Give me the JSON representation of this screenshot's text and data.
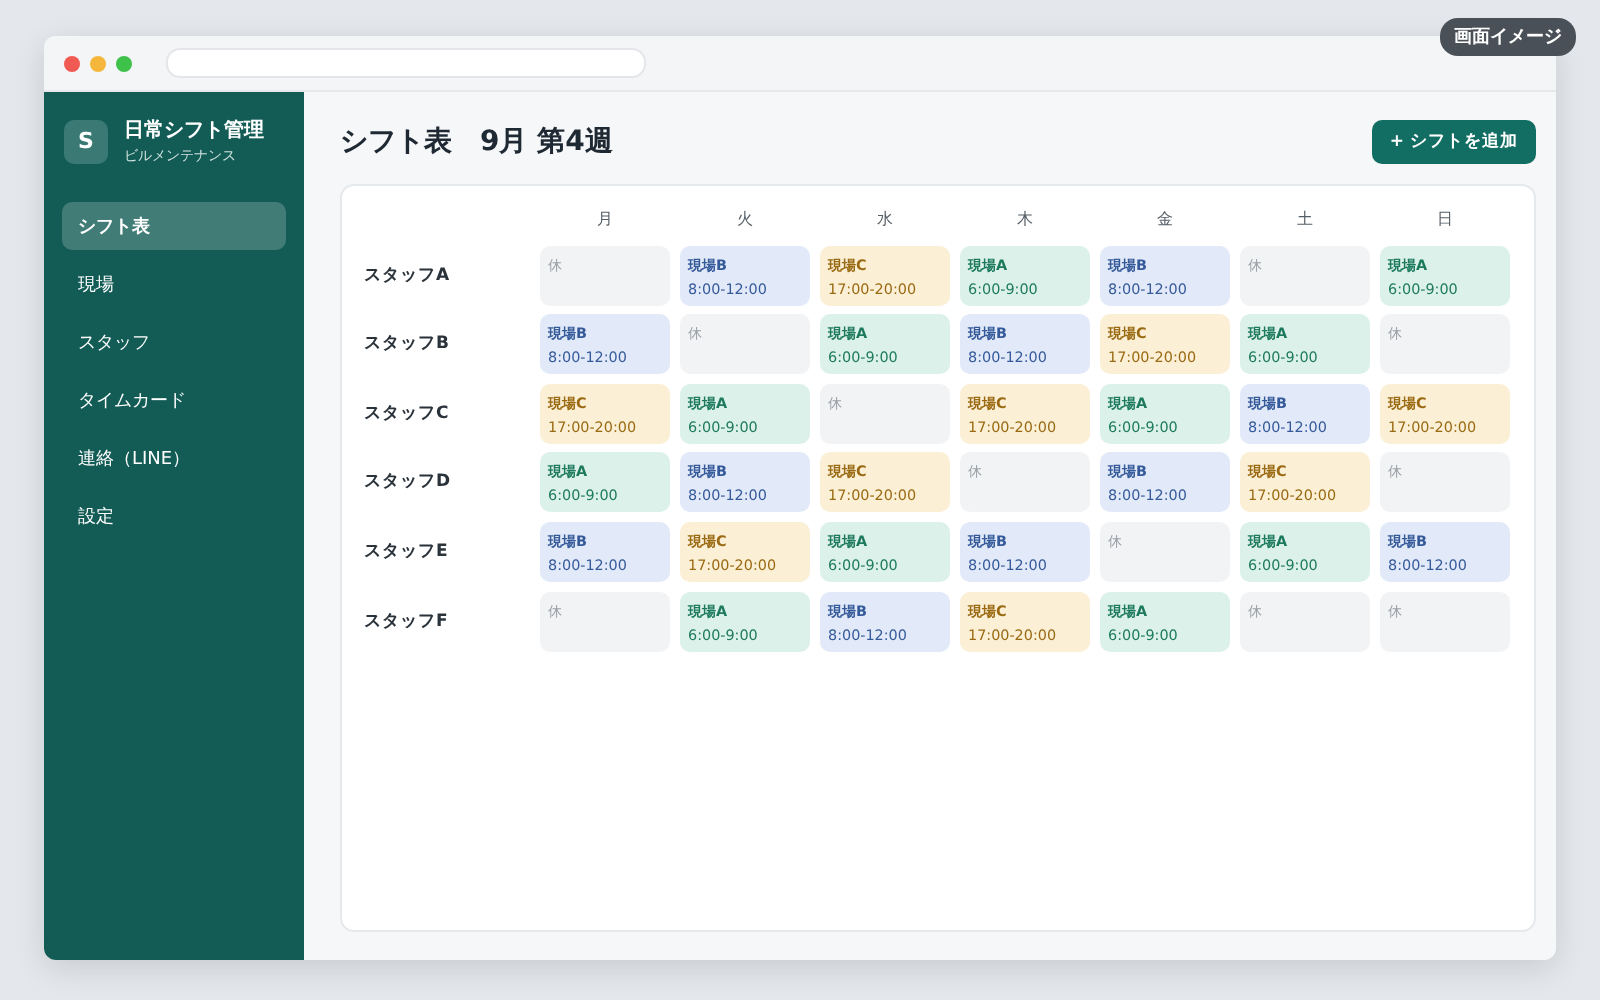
{
  "badge": "画面イメージ",
  "brand": {
    "initial": "S",
    "name": "日常シフト管理",
    "subtitle": "ビルメンテナンス"
  },
  "sidebar": {
    "items": [
      {
        "label": "シフト表",
        "selected": true
      },
      {
        "label": "現場",
        "selected": false
      },
      {
        "label": "スタッフ",
        "selected": false
      },
      {
        "label": "タイムカード",
        "selected": false
      },
      {
        "label": "連絡（LINE）",
        "selected": false
      },
      {
        "label": "設定",
        "selected": false
      }
    ]
  },
  "page_title": "シフト表　9月 第4週",
  "add_button": "+ シフトを追加",
  "table": {
    "columns": [
      "月",
      "火",
      "水",
      "木",
      "金",
      "土",
      "日"
    ],
    "rows": [
      {
        "staff": "スタッフA",
        "cells": [
          {
            "kind": "off",
            "label": "休"
          },
          {
            "kind": "b",
            "site": "現場B",
            "time": "8:00-12:00"
          },
          {
            "kind": "c",
            "site": "現場C",
            "time": "17:00-20:00"
          },
          {
            "kind": "a",
            "site": "現場A",
            "time": "6:00-9:00"
          },
          {
            "kind": "b",
            "site": "現場B",
            "time": "8:00-12:00"
          },
          {
            "kind": "off",
            "label": "休"
          },
          {
            "kind": "a",
            "site": "現場A",
            "time": "6:00-9:00"
          }
        ]
      },
      {
        "staff": "スタッフB",
        "cells": [
          {
            "kind": "b",
            "site": "現場B",
            "time": "8:00-12:00"
          },
          {
            "kind": "off",
            "label": "休"
          },
          {
            "kind": "a",
            "site": "現場A",
            "time": "6:00-9:00"
          },
          {
            "kind": "b",
            "site": "現場B",
            "time": "8:00-12:00"
          },
          {
            "kind": "c",
            "site": "現場C",
            "time": "17:00-20:00"
          },
          {
            "kind": "a",
            "site": "現場A",
            "time": "6:00-9:00"
          },
          {
            "kind": "off",
            "label": "休"
          }
        ]
      },
      {
        "staff": "スタッフC",
        "cells": [
          {
            "kind": "c",
            "site": "現場C",
            "time": "17:00-20:00"
          },
          {
            "kind": "a",
            "site": "現場A",
            "time": "6:00-9:00"
          },
          {
            "kind": "off",
            "label": "休"
          },
          {
            "kind": "c",
            "site": "現場C",
            "time": "17:00-20:00"
          },
          {
            "kind": "a",
            "site": "現場A",
            "time": "6:00-9:00"
          },
          {
            "kind": "b",
            "site": "現場B",
            "time": "8:00-12:00"
          },
          {
            "kind": "c",
            "site": "現場C",
            "time": "17:00-20:00"
          }
        ]
      },
      {
        "staff": "スタッフD",
        "cells": [
          {
            "kind": "a",
            "site": "現場A",
            "time": "6:00-9:00"
          },
          {
            "kind": "b",
            "site": "現場B",
            "time": "8:00-12:00"
          },
          {
            "kind": "c",
            "site": "現場C",
            "time": "17:00-20:00"
          },
          {
            "kind": "off",
            "label": "休"
          },
          {
            "kind": "b",
            "site": "現場B",
            "time": "8:00-12:00"
          },
          {
            "kind": "c",
            "site": "現場C",
            "time": "17:00-20:00"
          },
          {
            "kind": "off",
            "label": "休"
          }
        ]
      },
      {
        "staff": "スタッフE",
        "cells": [
          {
            "kind": "b",
            "site": "現場B",
            "time": "8:00-12:00"
          },
          {
            "kind": "c",
            "site": "現場C",
            "time": "17:00-20:00"
          },
          {
            "kind": "a",
            "site": "現場A",
            "time": "6:00-9:00"
          },
          {
            "kind": "b",
            "site": "現場B",
            "time": "8:00-12:00"
          },
          {
            "kind": "off",
            "label": "休"
          },
          {
            "kind": "a",
            "site": "現場A",
            "time": "6:00-9:00"
          },
          {
            "kind": "b",
            "site": "現場B",
            "time": "8:00-12:00"
          }
        ]
      },
      {
        "staff": "スタッフF",
        "cells": [
          {
            "kind": "off",
            "label": "休"
          },
          {
            "kind": "a",
            "site": "現場A",
            "time": "6:00-9:00"
          },
          {
            "kind": "b",
            "site": "現場B",
            "time": "8:00-12:00"
          },
          {
            "kind": "c",
            "site": "現場C",
            "time": "17:00-20:00"
          },
          {
            "kind": "a",
            "site": "現場A",
            "time": "6:00-9:00"
          },
          {
            "kind": "off",
            "label": "休"
          },
          {
            "kind": "off",
            "label": "休"
          }
        ]
      }
    ]
  }
}
